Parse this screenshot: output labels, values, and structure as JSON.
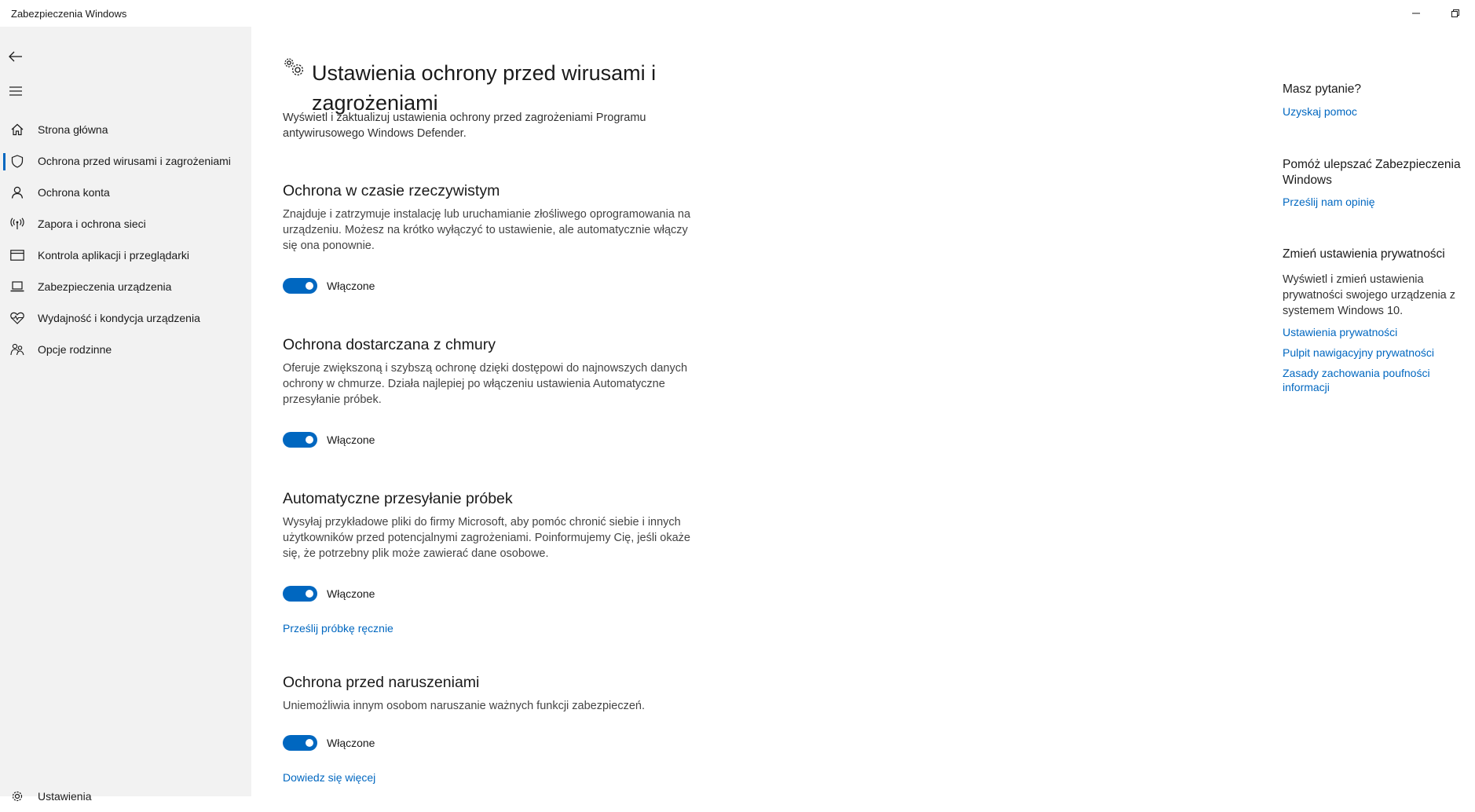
{
  "window": {
    "title": "Zabezpieczenia Windows"
  },
  "sidebar": {
    "items": [
      {
        "label": "Strona główna",
        "icon": "home-icon"
      },
      {
        "label": "Ochrona przed wirusami i zagrożeniami",
        "icon": "shield-icon",
        "active": true
      },
      {
        "label": "Ochrona konta",
        "icon": "person-icon"
      },
      {
        "label": "Zapora i ochrona sieci",
        "icon": "wireless-icon"
      },
      {
        "label": "Kontrola aplikacji i przeglądarki",
        "icon": "browser-window-icon"
      },
      {
        "label": "Zabezpieczenia urządzenia",
        "icon": "laptop-icon"
      },
      {
        "label": "Wydajność i kondycja urządzenia",
        "icon": "heart-pulse-icon"
      },
      {
        "label": "Opcje rodzinne",
        "icon": "family-icon"
      }
    ],
    "settings_label": "Ustawienia"
  },
  "main": {
    "title": "Ustawienia ochrony przed wirusami i zagrożeniami",
    "description": "Wyświetl i zaktualizuj ustawienia ochrony przed zagrożeniami Programu antywirusowego Windows Defender.",
    "sections": [
      {
        "heading": "Ochrona w czasie rzeczywistym",
        "description": "Znajduje i zatrzymuje instalację lub uruchamianie złośliwego oprogramowania na urządzeniu. Możesz na krótko wyłączyć to ustawienie, ale automatycznie włączy się ona ponownie.",
        "toggle_on": true,
        "toggle_label": "Włączone"
      },
      {
        "heading": "Ochrona dostarczana z chmury",
        "description": "Oferuje zwiększoną i szybszą ochronę dzięki dostępowi do najnowszych danych ochrony w chmurze. Działa najlepiej po włączeniu ustawienia Automatyczne przesyłanie próbek.",
        "toggle_on": true,
        "toggle_label": "Włączone"
      },
      {
        "heading": "Automatyczne przesyłanie próbek",
        "description": "Wysyłaj przykładowe pliki do firmy Microsoft, aby pomóc chronić siebie i innych użytkowników przed potencjalnymi zagrożeniami. Poinformujemy Cię, jeśli okaże się, że potrzebny plik może zawierać dane osobowe.",
        "toggle_on": true,
        "toggle_label": "Włączone",
        "link": "Prześlij próbkę ręcznie"
      },
      {
        "heading": "Ochrona przed naruszeniami",
        "description": "Uniemożliwia innym osobom naruszanie ważnych funkcji zabezpieczeń.",
        "toggle_on": true,
        "toggle_label": "Włączone",
        "link": "Dowiedz się więcej"
      }
    ]
  },
  "aside": {
    "question_heading": "Masz pytanie?",
    "help_link": "Uzyskaj pomoc",
    "improve_heading": "Pomóż ulepszać Zabezpieczenia Windows",
    "feedback_link": "Prześlij nam opinię",
    "privacy_heading": "Zmień ustawienia prywatności",
    "privacy_text": "Wyświetl i zmień ustawienia prywatności swojego urządzenia z systemem Windows 10.",
    "privacy_links": [
      "Ustawienia prywatności",
      "Pulpit nawigacyjny prywatności",
      "Zasady zachowania poufności informacji"
    ]
  },
  "colors": {
    "accent": "#0067c0",
    "sidebar_bg": "#f2f2f2"
  }
}
